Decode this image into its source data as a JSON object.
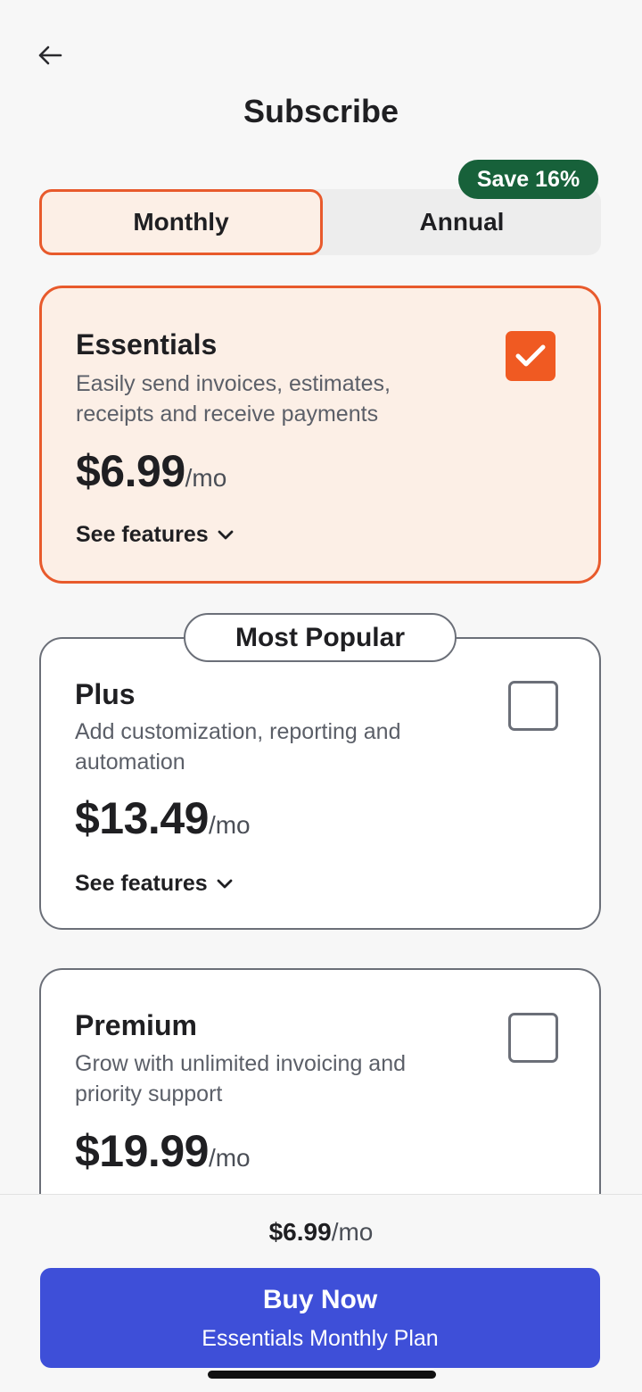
{
  "header": {
    "title": "Subscribe"
  },
  "billing_toggle": {
    "monthly_label": "Monthly",
    "annual_label": "Annual",
    "save_badge": "Save 16%",
    "selected": "Monthly"
  },
  "plans": [
    {
      "name": "Essentials",
      "description": "Easily send invoices, estimates, receipts and receive payments",
      "price": "$6.99",
      "unit": "/mo",
      "see_features": "See features",
      "selected": true
    },
    {
      "name": "Plus",
      "badge": "Most Popular",
      "description": "Add customization, reporting and automation",
      "price": "$13.49",
      "unit": "/mo",
      "see_features": "See features",
      "selected": false
    },
    {
      "name": "Premium",
      "description": "Grow with unlimited invoicing and priority support",
      "price": "$19.99",
      "unit": "/mo",
      "selected": false
    }
  ],
  "footer": {
    "price": "$6.99",
    "unit": "/mo",
    "buy_label": "Buy Now",
    "buy_sublabel": "Essentials Monthly Plan"
  },
  "colors": {
    "accent": "#e85a2c",
    "selected_bg": "#fcefe6",
    "badge_green": "#17613a",
    "buy_button": "#3e4fd8"
  },
  "icons": {
    "back": "arrow-left-icon",
    "check": "checkmark-icon",
    "expand": "chevron-down-icon"
  }
}
